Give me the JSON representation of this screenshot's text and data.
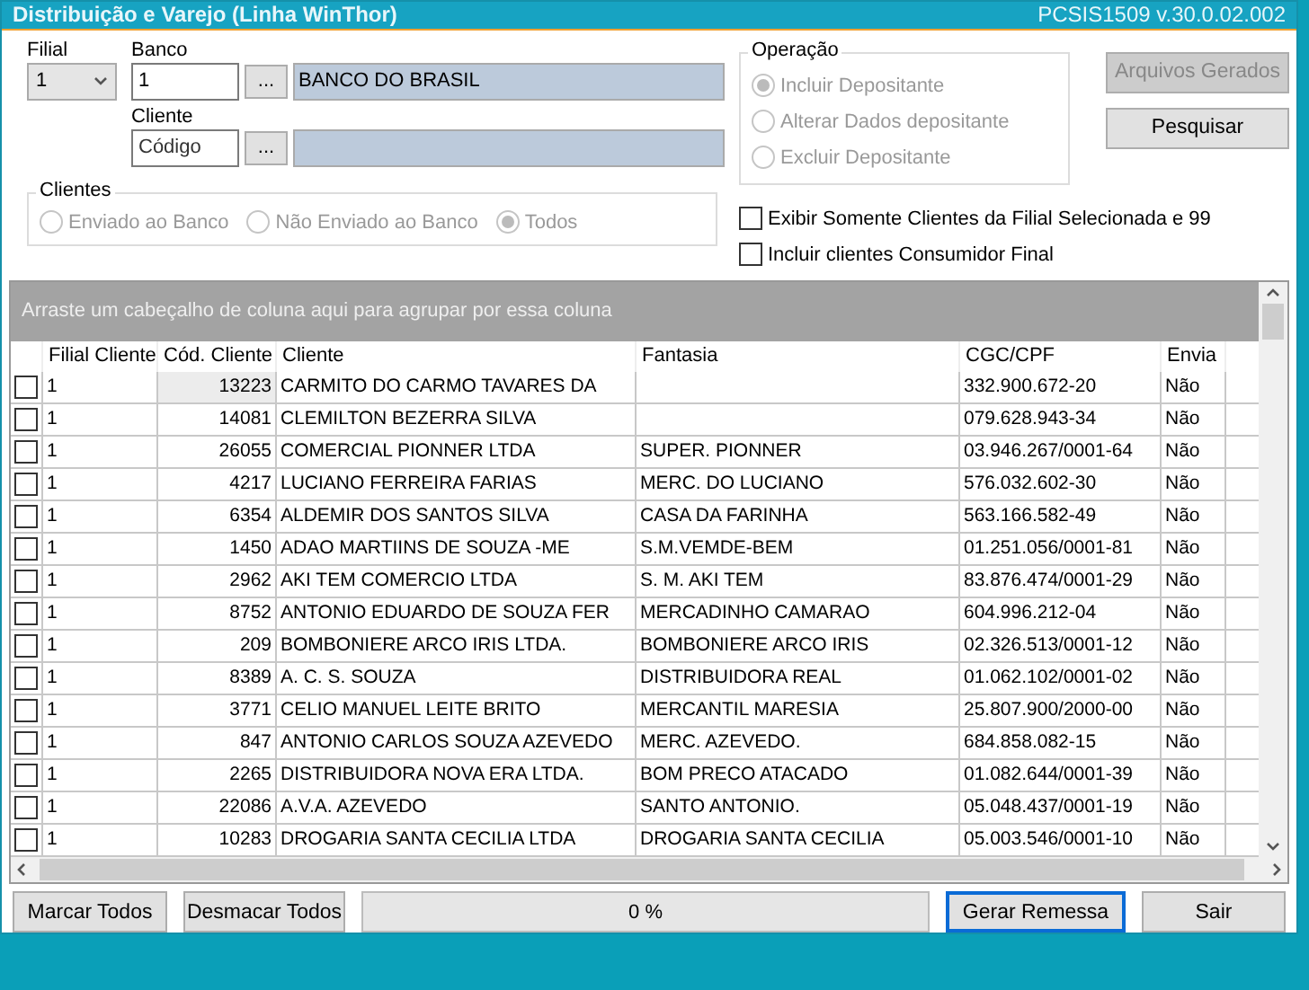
{
  "window": {
    "title": "Distribuição e Varejo (Linha WinThor)",
    "version": "PCSIS1509  v.30.0.02.002"
  },
  "filial": {
    "label": "Filial",
    "value": "1"
  },
  "banco": {
    "label": "Banco",
    "value": "1",
    "lookup": "...",
    "name": "BANCO DO BRASIL"
  },
  "cliente": {
    "label": "Cliente",
    "placeholder": "Código",
    "lookup": "...",
    "name_disabled": true
  },
  "operacao": {
    "title": "Operação",
    "options": [
      {
        "label": "Incluir Depositante",
        "selected": true,
        "disabled": true
      },
      {
        "label": "Alterar Dados depositante",
        "selected": false,
        "disabled": true
      },
      {
        "label": "Excluir Depositante",
        "selected": false,
        "disabled": true
      }
    ]
  },
  "side_buttons": [
    {
      "label": "Arquivos Gerados",
      "disabled": true
    },
    {
      "label": "Pesquisar",
      "disabled": false
    }
  ],
  "clientes": {
    "title": "Clientes",
    "options": [
      {
        "label": "Enviado ao Banco",
        "selected": false,
        "disabled": true
      },
      {
        "label": "Não Enviado ao Banco",
        "selected": false,
        "disabled": true
      },
      {
        "label": "Todos",
        "selected": true,
        "disabled": true
      }
    ]
  },
  "options": [
    {
      "label": "Exibir Somente Clientes da Filial Selecionada e  99",
      "checked": false
    },
    {
      "label": "Incluir clientes Consumidor Final",
      "checked": false
    }
  ],
  "grid": {
    "group_hint": "Arraste um cabeçalho de coluna aqui para agrupar por essa coluna",
    "columns": [
      "Filial Cliente",
      "Cód. Cliente",
      "Cliente",
      "Fantasia",
      "CGC/CPF",
      "Envia"
    ],
    "rows": [
      {
        "checked": false,
        "selected": true,
        "cells": [
          "1",
          "13223",
          "CARMITO DO CARMO TAVARES DA",
          "",
          "332.900.672-20",
          "Não"
        ]
      },
      {
        "checked": false,
        "selected": false,
        "cells": [
          "1",
          "14081",
          "CLEMILTON BEZERRA SILVA",
          "",
          "079.628.943-34",
          "Não"
        ]
      },
      {
        "checked": false,
        "selected": false,
        "cells": [
          "1",
          "26055",
          "COMERCIAL PIONNER LTDA",
          "SUPER. PIONNER",
          "03.946.267/0001-64",
          "Não"
        ]
      },
      {
        "checked": false,
        "selected": false,
        "cells": [
          "1",
          "4217",
          "LUCIANO FERREIRA FARIAS",
          "MERC. DO LUCIANO",
          "576.032.602-30",
          "Não"
        ]
      },
      {
        "checked": false,
        "selected": false,
        "cells": [
          "1",
          "6354",
          "ALDEMIR DOS SANTOS SILVA",
          "CASA DA FARINHA",
          "563.166.582-49",
          "Não"
        ]
      },
      {
        "checked": false,
        "selected": false,
        "cells": [
          "1",
          "1450",
          "ADAO MARTIINS DE SOUZA -ME",
          "S.M.VEMDE-BEM",
          "01.251.056/0001-81",
          "Não"
        ]
      },
      {
        "checked": false,
        "selected": false,
        "cells": [
          "1",
          "2962",
          "AKI TEM COMERCIO LTDA",
          "S. M. AKI TEM",
          "83.876.474/0001-29",
          "Não"
        ]
      },
      {
        "checked": false,
        "selected": false,
        "cells": [
          "1",
          "8752",
          "ANTONIO EDUARDO DE SOUZA FER",
          "MERCADINHO CAMARAO",
          "604.996.212-04",
          "Não"
        ]
      },
      {
        "checked": false,
        "selected": false,
        "cells": [
          "1",
          "209",
          "BOMBONIERE ARCO IRIS LTDA.",
          "BOMBONIERE ARCO IRIS",
          "02.326.513/0001-12",
          "Não"
        ]
      },
      {
        "checked": false,
        "selected": false,
        "cells": [
          "1",
          "8389",
          "A. C. S. SOUZA",
          "DISTRIBUIDORA REAL",
          "01.062.102/0001-02",
          "Não"
        ]
      },
      {
        "checked": false,
        "selected": false,
        "cells": [
          "1",
          "3771",
          "CELIO MANUEL LEITE BRITO",
          "MERCANTIL MARESIA",
          "25.807.900/2000-00",
          "Não"
        ]
      },
      {
        "checked": false,
        "selected": false,
        "cells": [
          "1",
          "847",
          "ANTONIO CARLOS SOUZA AZEVEDO",
          "MERC. AZEVEDO.",
          "684.858.082-15",
          "Não"
        ]
      },
      {
        "checked": false,
        "selected": false,
        "cells": [
          "1",
          "2265",
          "DISTRIBUIDORA NOVA ERA LTDA.",
          "BOM PRECO ATACADO",
          "01.082.644/0001-39",
          "Não"
        ]
      },
      {
        "checked": false,
        "selected": false,
        "cells": [
          "1",
          "22086",
          "A.V.A. AZEVEDO",
          "SANTO ANTONIO.",
          "05.048.437/0001-19",
          "Não"
        ]
      },
      {
        "checked": false,
        "selected": false,
        "cells": [
          "1",
          "10283",
          "DROGARIA SANTA CECILIA LTDA",
          "DROGARIA SANTA CECILIA",
          "05.003.546/0001-10",
          "Não"
        ]
      }
    ]
  },
  "footer": {
    "buttons": [
      {
        "label": "Marcar Todos",
        "default": false
      },
      {
        "label": "Desmacar Todos",
        "default": false
      }
    ],
    "progress": {
      "label": "0 %",
      "level": 0
    },
    "actions": [
      {
        "label": "Gerar Remessa",
        "default": true
      },
      {
        "label": "Sair",
        "default": false
      }
    ]
  }
}
